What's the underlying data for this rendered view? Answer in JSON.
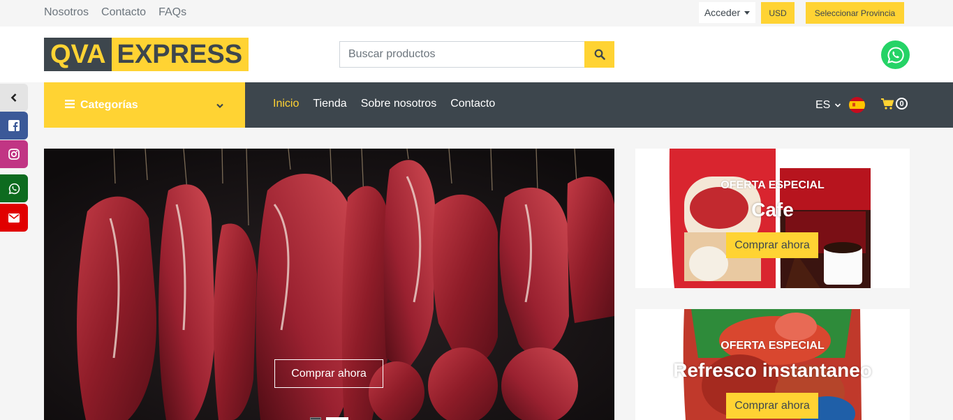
{
  "topbar": {
    "links": [
      "Nosotros",
      "Contacto",
      "FAQs"
    ],
    "login_label": "Acceder",
    "currency_label": "USD",
    "province_label": "Seleccionar Provincia"
  },
  "header": {
    "logo_part1": "QVA",
    "logo_part2": "EXPRESS",
    "search_placeholder": "Buscar productos"
  },
  "nav": {
    "categories_label": "Categorías",
    "links": [
      {
        "label": "Inicio",
        "active": true
      },
      {
        "label": "Tienda",
        "active": false
      },
      {
        "label": "Sobre nosotros",
        "active": false
      },
      {
        "label": "Contacto",
        "active": false
      }
    ],
    "language": "ES",
    "cart_count": "0"
  },
  "social": [
    "chevron-left-icon",
    "facebook-icon",
    "instagram-icon",
    "whatsapp-icon",
    "envelope-icon"
  ],
  "hero": {
    "button_label": "Comprar ahora",
    "slide_count": 2,
    "active_slide": 2
  },
  "offers": [
    {
      "label": "OFERTA ESPECIAL",
      "title": "Cafe",
      "button": "Comprar ahora"
    },
    {
      "label": "OFERTA ESPECIAL",
      "title": "Refresco instantaneo",
      "button": "Comprar ahora"
    }
  ],
  "colors": {
    "accent": "#ffd333",
    "dark": "#3d464d",
    "whatsapp": "#25d366"
  }
}
